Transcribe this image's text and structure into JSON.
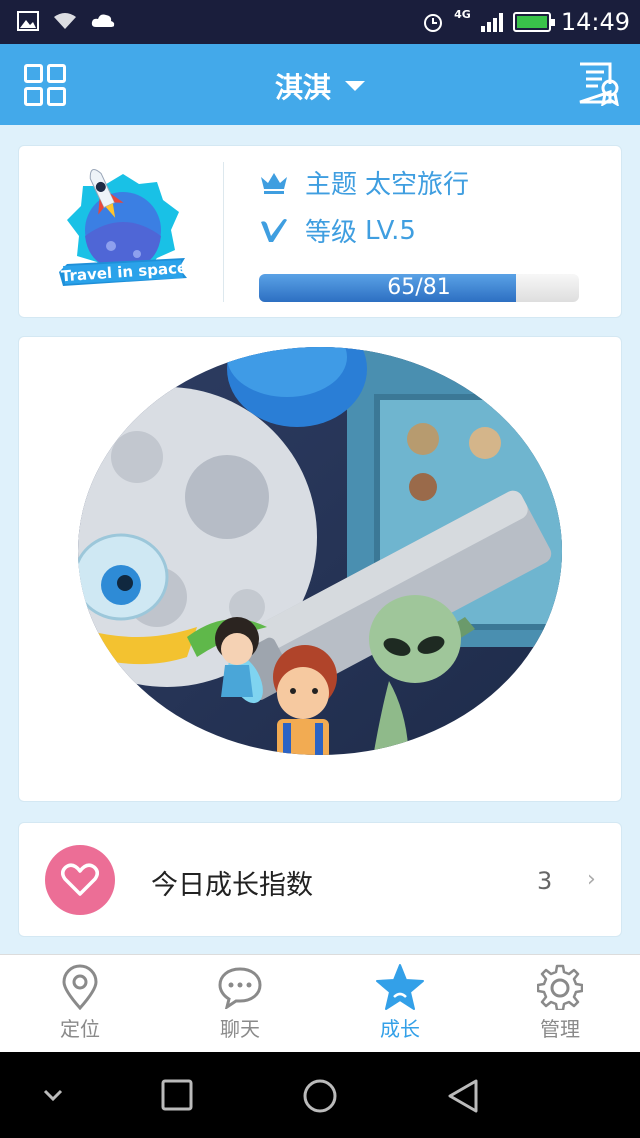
{
  "status_bar": {
    "network": "4G",
    "time": "14:49"
  },
  "header": {
    "title": "淇淇"
  },
  "theme": {
    "badge_text": "Travel in space",
    "theme_label": "主题",
    "theme_value": "太空旅行",
    "level_label": "等级",
    "level_value": "LV.5",
    "progress_text": "65/81",
    "progress_current": 65,
    "progress_max": 81
  },
  "growth": {
    "label": "今日成长指数",
    "value": "3",
    "chevron": "›"
  },
  "tabs": [
    {
      "label": "定位",
      "icon": "location-pin-icon",
      "active": false
    },
    {
      "label": "聊天",
      "icon": "chat-bubble-icon",
      "active": false
    },
    {
      "label": "成长",
      "icon": "star-icon",
      "active": true
    },
    {
      "label": "管理",
      "icon": "gear-icon",
      "active": false
    }
  ],
  "colors": {
    "accent": "#43a9ea",
    "active_tab": "#33a0e8",
    "heart": "#ec6e96",
    "status_bar": "#1a1e3c"
  }
}
